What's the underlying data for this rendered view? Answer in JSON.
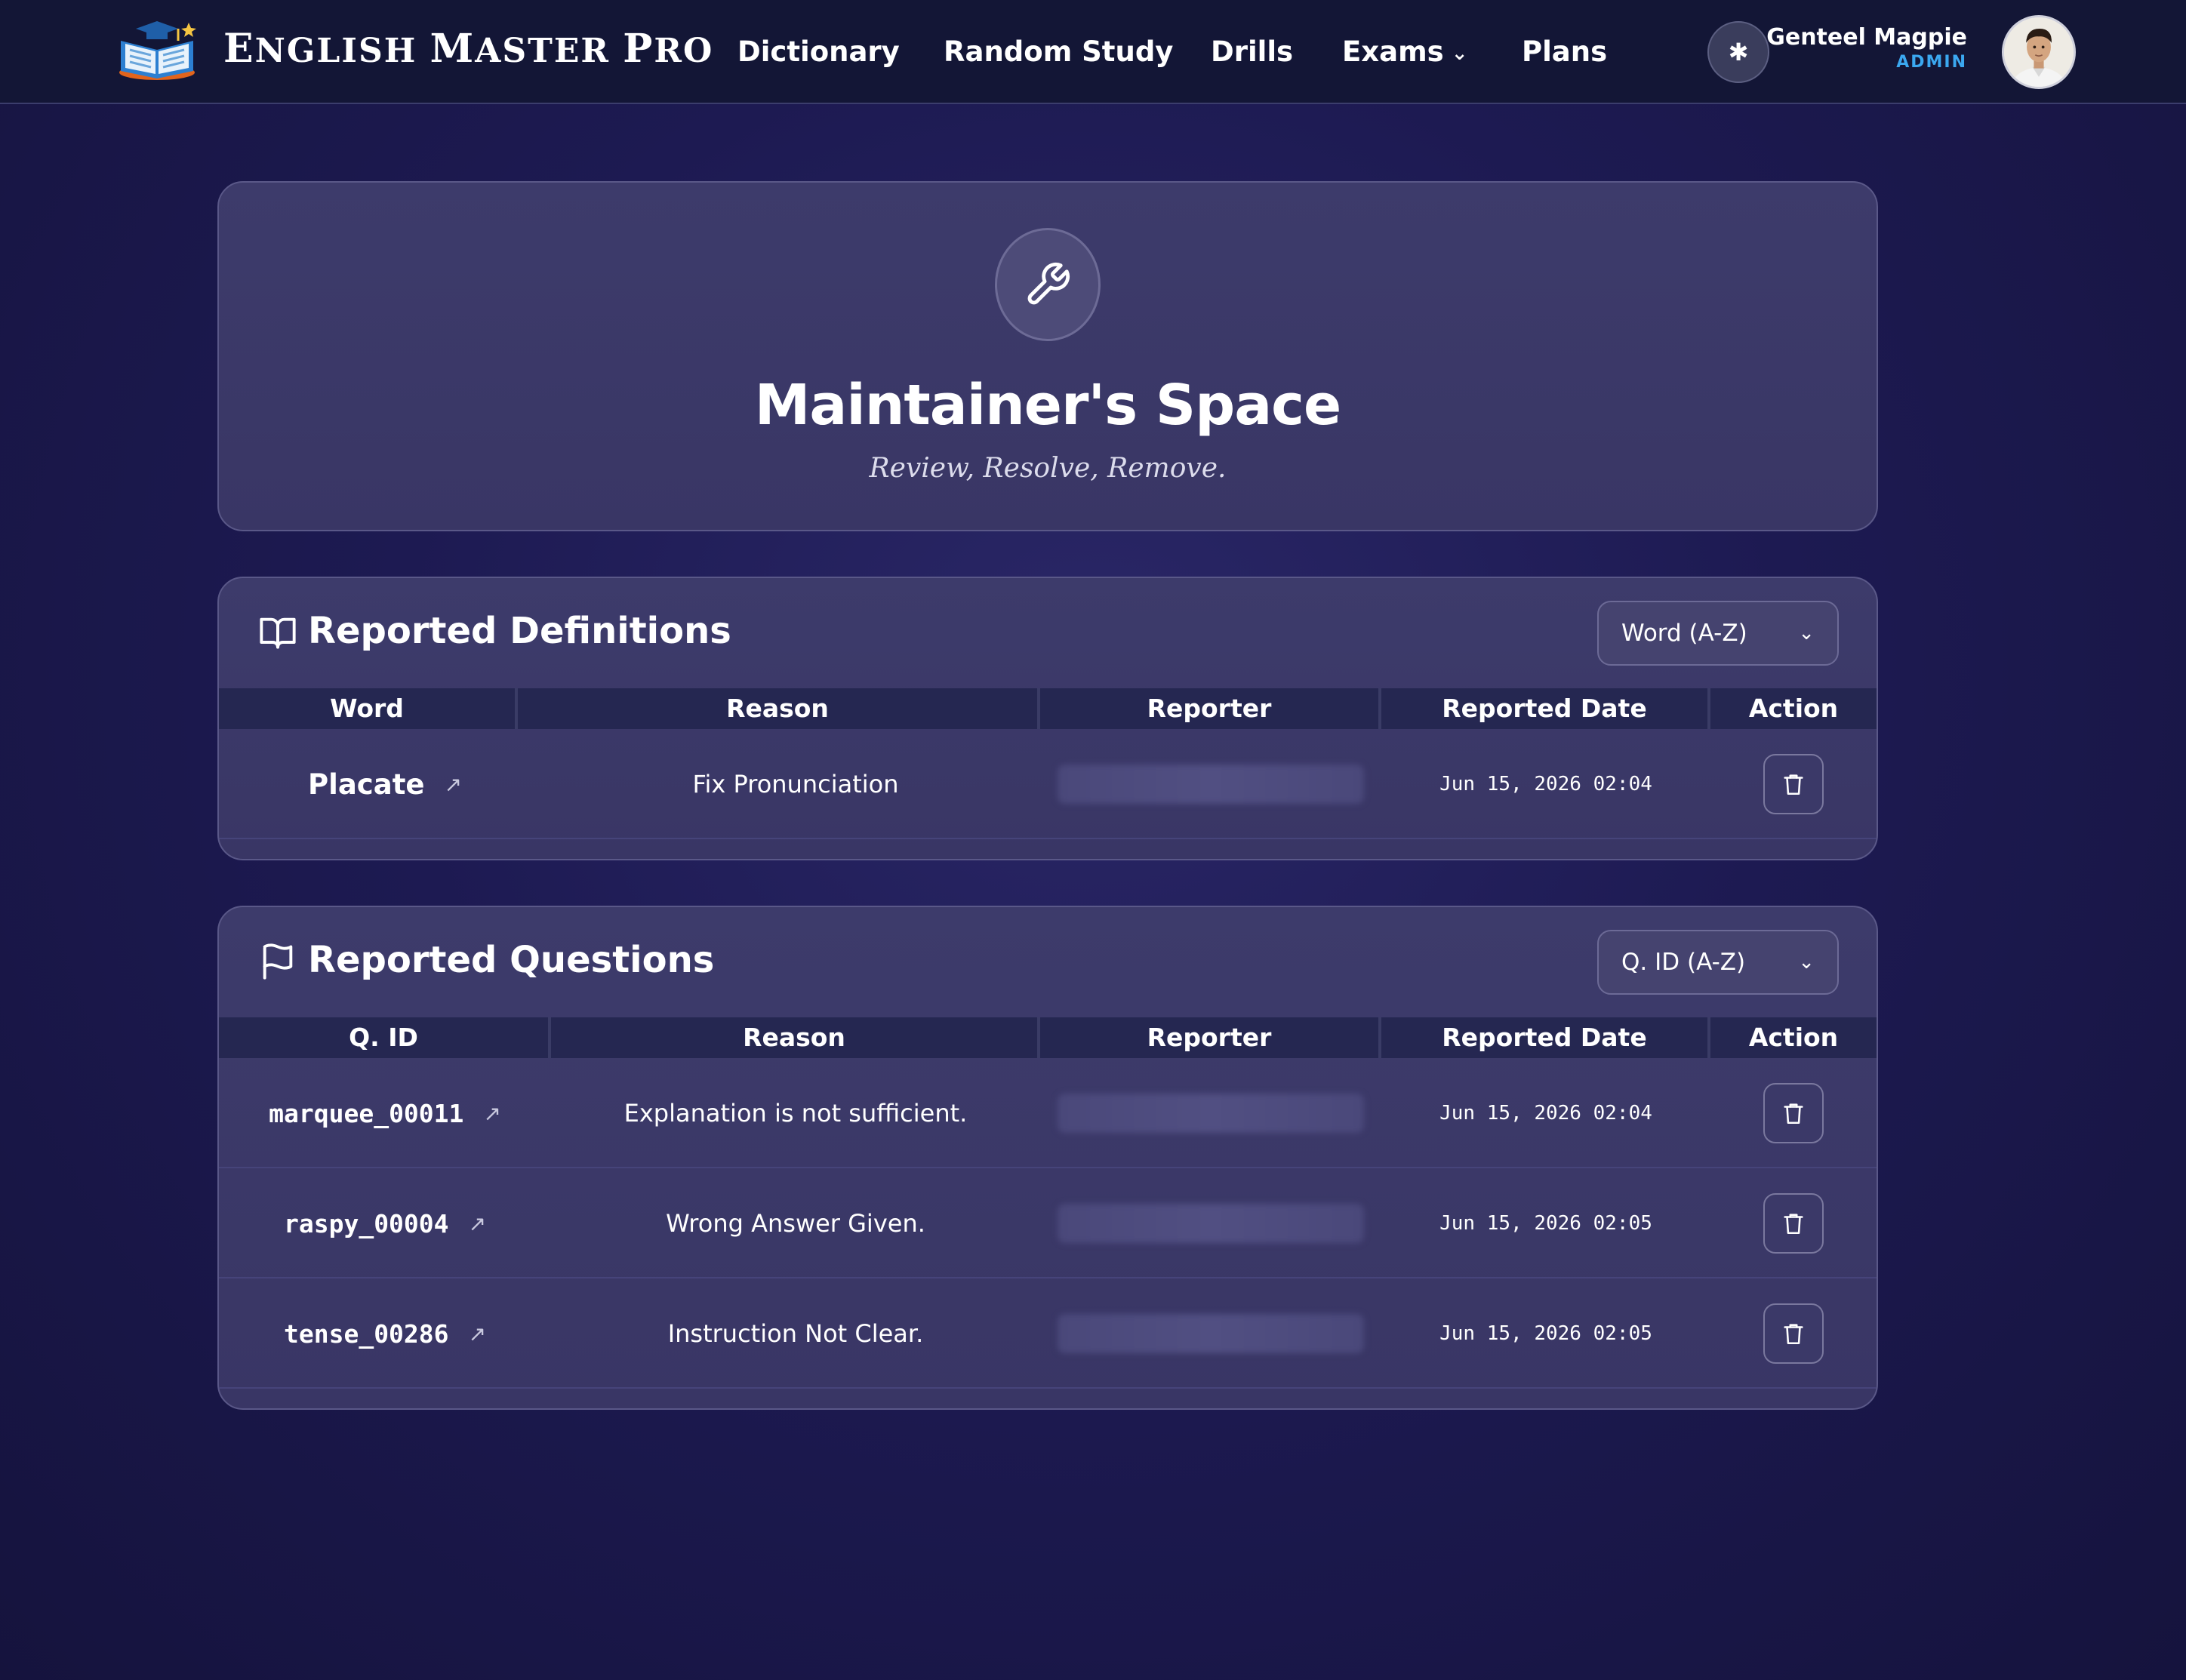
{
  "navbar": {
    "brand": "English Master Pro",
    "links": {
      "dictionary": "Dictionary",
      "random_study": "Random Study",
      "drills": "Drills",
      "exams": "Exams",
      "plans": "Plans"
    },
    "theme_icon": "asterisk-icon",
    "user": {
      "name": "Genteel Magpie",
      "role": "ADMIN"
    }
  },
  "hero": {
    "icon": "wrench-icon",
    "title": "Maintainer's Space",
    "subtitle": "Review, Resolve, Remove."
  },
  "definitions": {
    "icon": "book-open-icon",
    "title": "Reported Definitions",
    "sort_value": "Word (A-Z)",
    "columns": [
      "Word",
      "Reason",
      "Reporter",
      "Reported Date",
      "Action"
    ],
    "rows": [
      {
        "word": "Placate",
        "reason": "Fix Pronunciation",
        "date": "Jun 15, 2026 02:04"
      }
    ]
  },
  "questions": {
    "icon": "flag-icon",
    "title": "Reported Questions",
    "sort_value": "Q. ID (A-Z)",
    "columns": [
      "Q. ID",
      "Reason",
      "Reporter",
      "Reported Date",
      "Action"
    ],
    "rows": [
      {
        "qid": "marquee_00011",
        "reason": "Explanation is not sufficient.",
        "date": "Jun 15, 2026 02:04"
      },
      {
        "qid": "raspy_00004",
        "reason": "Wrong Answer Given.",
        "date": "Jun 15, 2026 02:05"
      },
      {
        "qid": "tense_00286",
        "reason": "Instruction Not Clear.",
        "date": "Jun 15, 2026 02:05"
      }
    ]
  },
  "colors": {
    "navbar_bg": "#131636",
    "page_bg": "#1d1a52",
    "card_bg": "#3d3b6b",
    "accent_role": "#3ba8f0"
  }
}
